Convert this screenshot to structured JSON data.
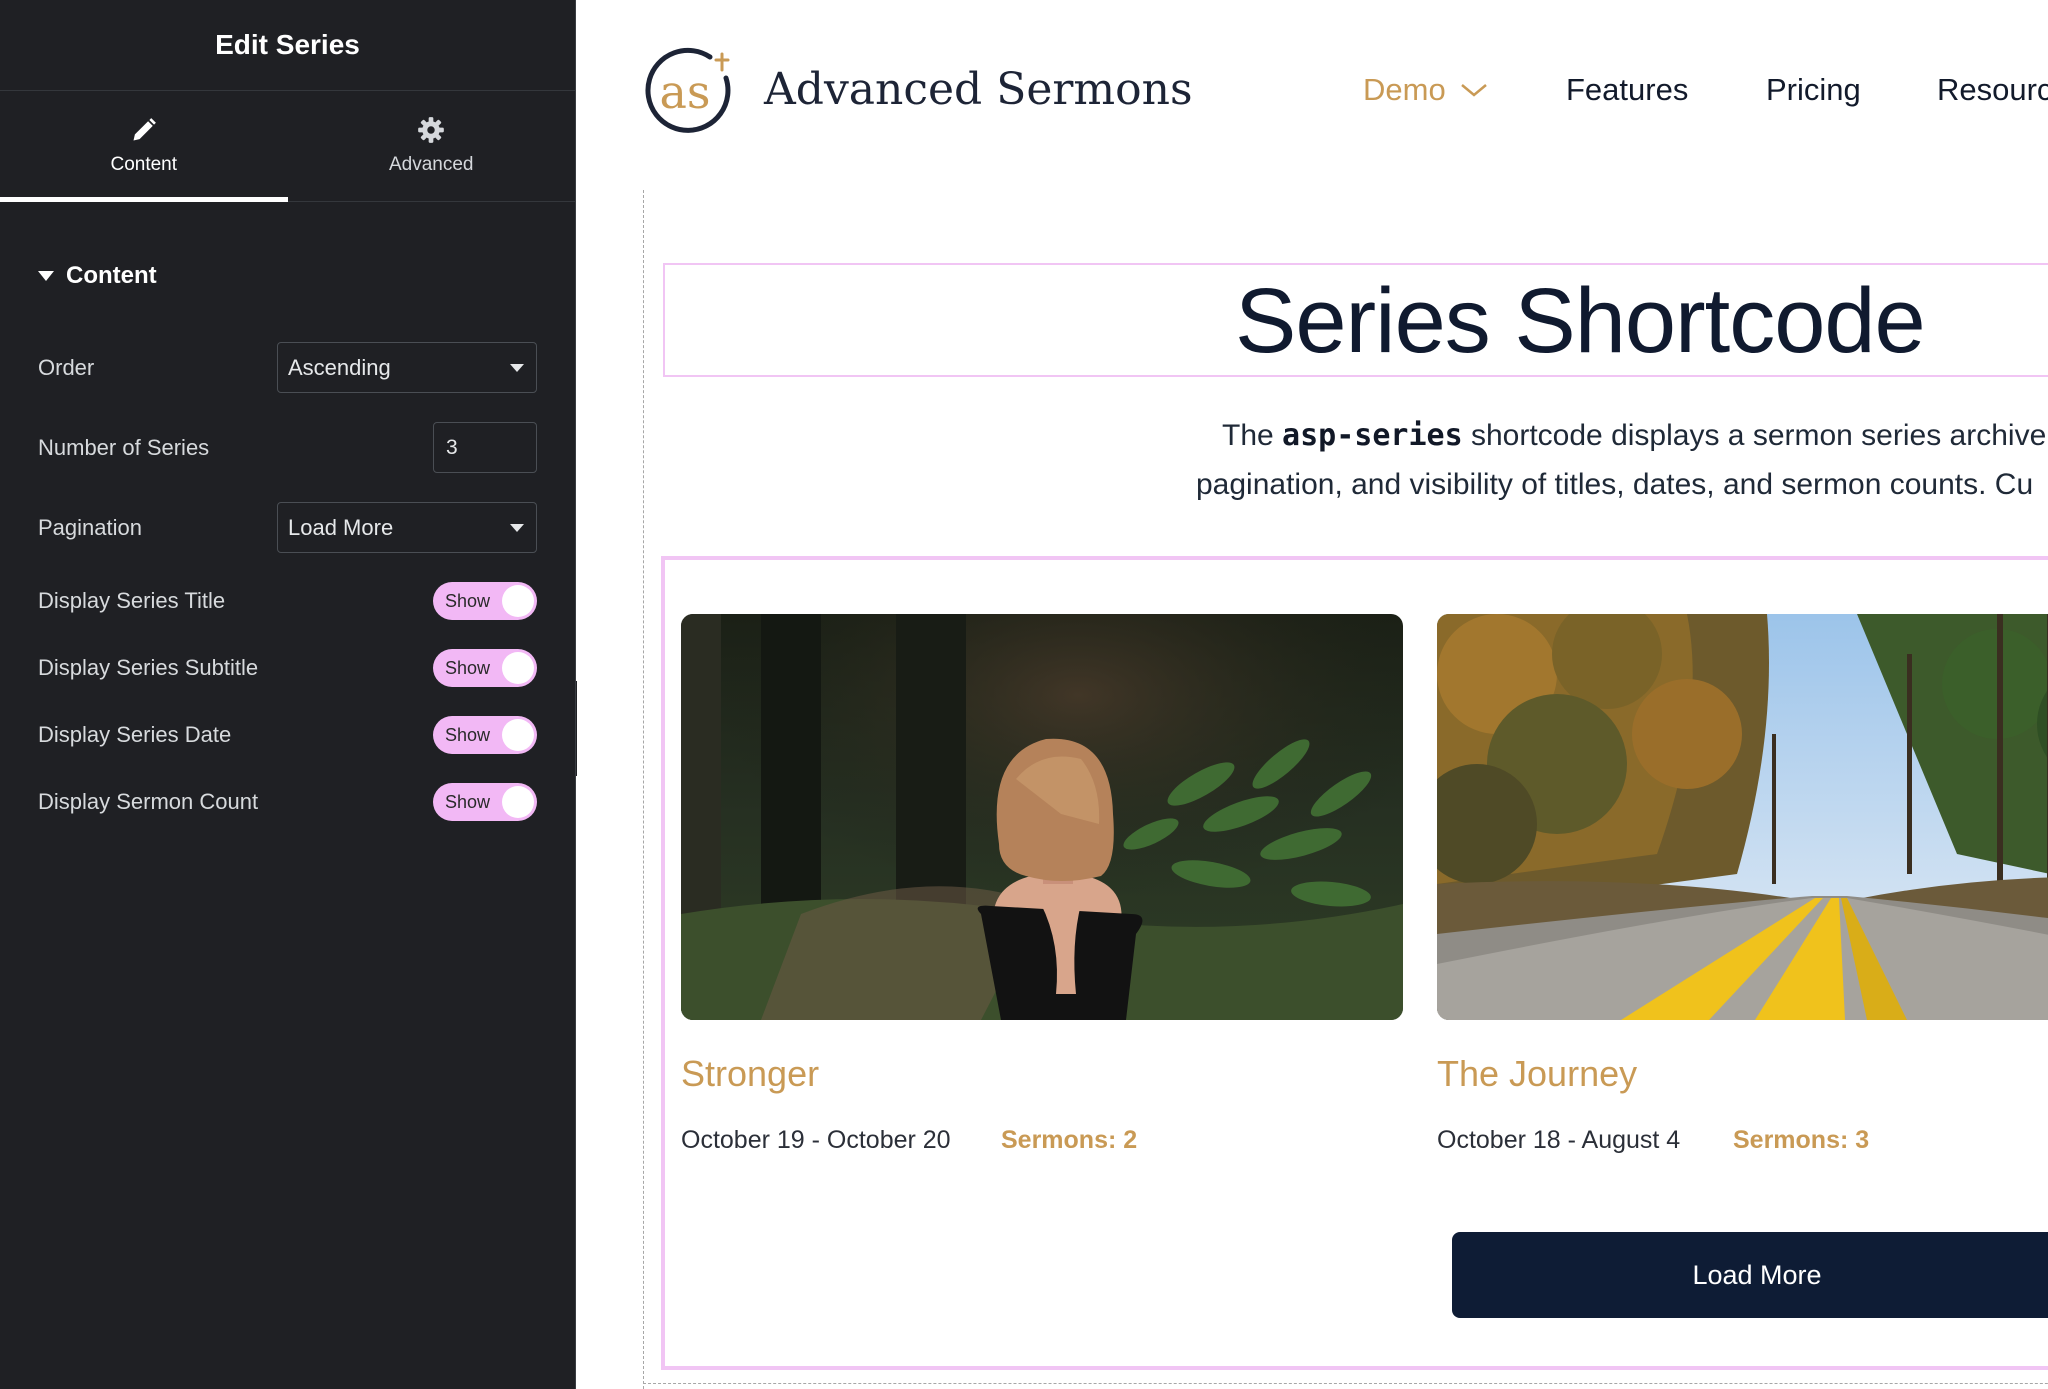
{
  "panel": {
    "title": "Edit Series",
    "tabs": [
      {
        "label": "Content",
        "icon": "pencil-icon",
        "active": true
      },
      {
        "label": "Advanced",
        "icon": "gear-icon",
        "active": false
      }
    ],
    "section_title": "Content",
    "controls": {
      "order": {
        "label": "Order",
        "value": "Ascending"
      },
      "number_of_series": {
        "label": "Number of Series",
        "value": "3"
      },
      "pagination": {
        "label": "Pagination",
        "value": "Load More"
      },
      "display_title": {
        "label": "Display Series Title",
        "state": "Show"
      },
      "display_subtitle": {
        "label": "Display Series Subtitle",
        "state": "Show"
      },
      "display_date": {
        "label": "Display Series Date",
        "state": "Show"
      },
      "display_count": {
        "label": "Display Sermon Count",
        "state": "Show"
      }
    }
  },
  "site": {
    "brand": "Advanced Sermons",
    "logo_text": "as",
    "nav": {
      "demo": "Demo",
      "features": "Features",
      "pricing": "Pricing",
      "resources": "Resources"
    },
    "page_title": "Series Shortcode",
    "intro": {
      "line1_pre": "The ",
      "line1_code": "asp-series",
      "line1_post": " shortcode displays a sermon series archive",
      "line2": "pagination, and visibility of titles, dates, and sermon counts. Cu"
    },
    "cards": [
      {
        "title": "Stronger",
        "date": "October 19 - October 20",
        "count": "Sermons: 2",
        "image": "woman-in-forest-photo"
      },
      {
        "title": "The Journey",
        "date": "October 18 - August 4",
        "count": "Sermons: 3",
        "image": "autumn-road-photo"
      }
    ],
    "load_more": "Load More"
  },
  "colors": {
    "panel_bg": "#1f2024",
    "accent_gold": "#c99a55",
    "navy": "#0e1c35",
    "toggle_pink": "#f2b8f5",
    "outline_pink": "#f1c5f4"
  }
}
